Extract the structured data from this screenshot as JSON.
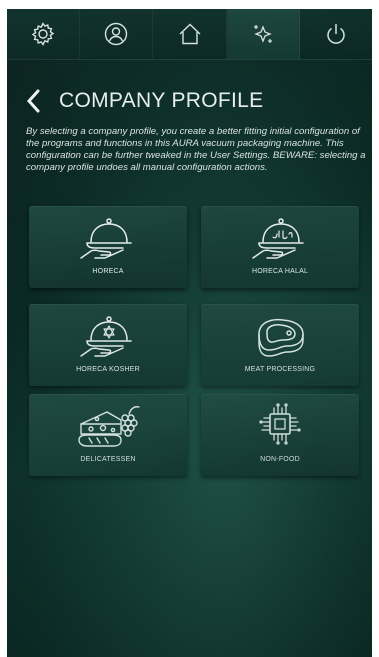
{
  "nav": {
    "icons": [
      "gear-icon",
      "user-icon",
      "home-icon",
      "sparkle-icon",
      "power-icon"
    ]
  },
  "header": {
    "title": "COMPANY PROFILE"
  },
  "description": "By selecting a company profile, you create a better fitting initial configuration of the programs and functions in this AURA vacuum packaging machine. This configuration can be further tweaked in the User Settings. BEWARE: selecting a company profile undoes all manual configuration actions.",
  "profiles": [
    {
      "label": "HORECA",
      "icon": "cloche-icon"
    },
    {
      "label": "HORECA HALAL",
      "icon": "cloche-halal-icon"
    },
    {
      "label": "HORECA KOSHER",
      "icon": "cloche-kosher-icon"
    },
    {
      "label": "MEAT PROCESSING",
      "icon": "steak-icon"
    },
    {
      "label": "DELICATESSEN",
      "icon": "cheese-bread-grapes-icon"
    },
    {
      "label": "NON-FOOD",
      "icon": "chip-icon"
    }
  ],
  "colors": {
    "background": "#0e2f2a",
    "card": "#1b423b",
    "text": "#e8eeed"
  }
}
